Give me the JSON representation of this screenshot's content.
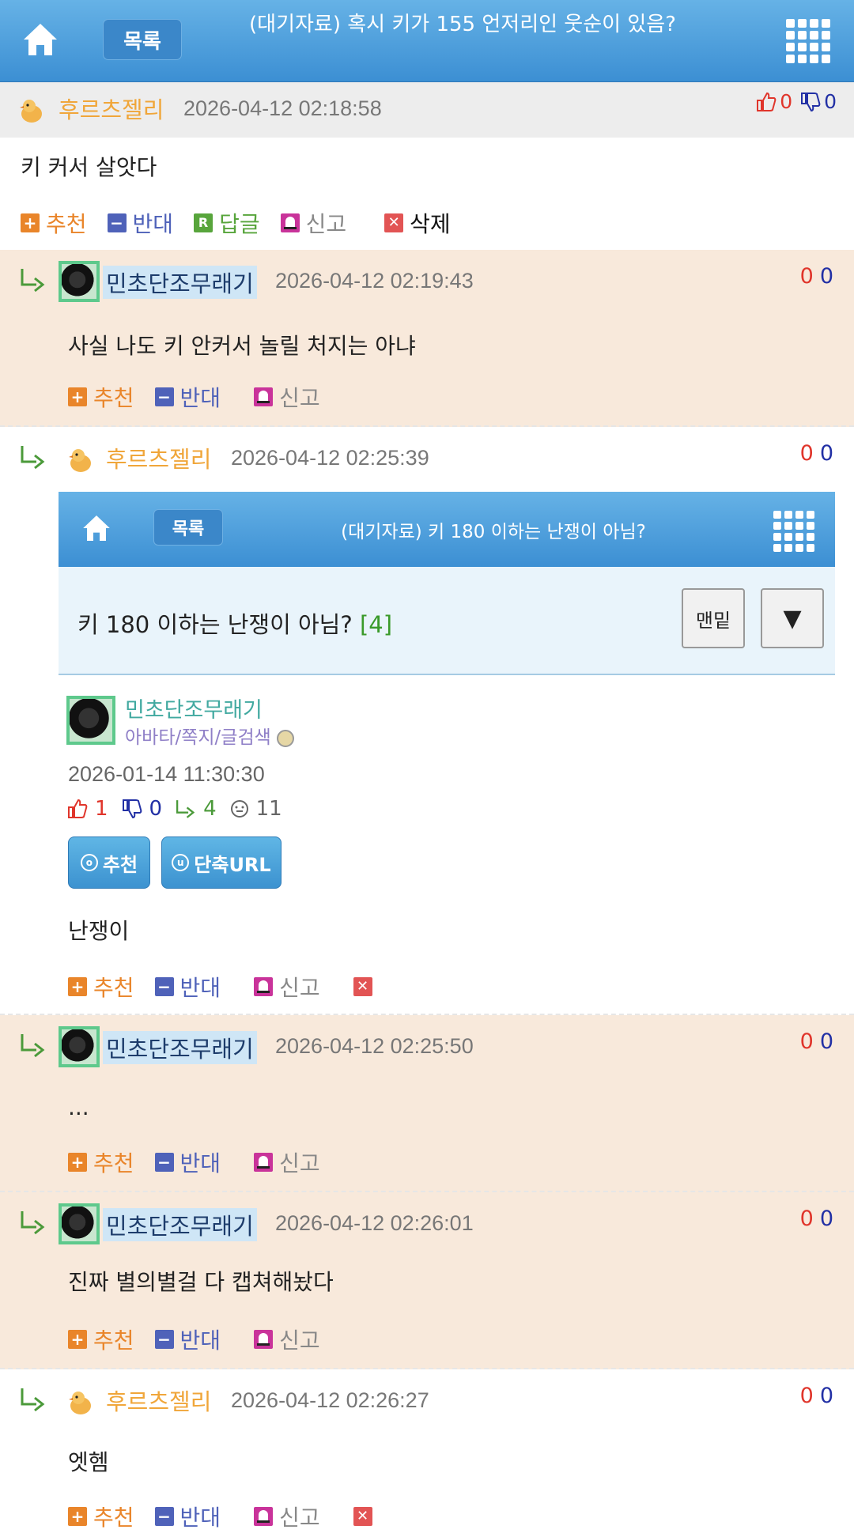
{
  "topbar": {
    "list_label": "목록",
    "title": "(대기자료) 혹시 키가 155 언저리인 웃순이 있음?"
  },
  "main_comment": {
    "nick": "후르츠젤리",
    "time": "2026-04-12 02:18:58",
    "up": "0",
    "down": "0",
    "text": "키 커서 살앗다",
    "actions": {
      "recommend": "추천",
      "oppose": "반대",
      "reply": "답글",
      "report": "신고",
      "delete": "삭제"
    }
  },
  "replies": [
    {
      "nick": "민초단조무래기",
      "time": "2026-04-12 02:19:43",
      "up": "0",
      "down": "0",
      "text": "사실 나도 키 안커서 놀릴 처지는 아냐"
    },
    {
      "nick": "후르츠젤리",
      "time": "2026-04-12 02:25:39",
      "up": "0",
      "down": "0",
      "text": "난쟁이"
    },
    {
      "nick": "민초단조무래기",
      "time": "2026-04-12 02:25:50",
      "up": "0",
      "down": "0",
      "text": "..."
    },
    {
      "nick": "민초단조무래기",
      "time": "2026-04-12 02:26:01",
      "up": "0",
      "down": "0",
      "text": "진짜 별의별걸 다 캡쳐해놨다"
    },
    {
      "nick": "후르츠젤리",
      "time": "2026-04-12 02:26:27",
      "up": "0",
      "down": "0",
      "text": "엣헴"
    }
  ],
  "reply_actions": {
    "recommend": "추천",
    "oppose": "반대",
    "report": "신고"
  },
  "embed": {
    "list_label": "목록",
    "title": "(대기자료) 키 180 이하는 난쟁이 아님?",
    "question": "키 180 이하는 난쟁이 아님?",
    "count": "[4]",
    "bottom_btn": "맨밑",
    "down_btn": "▼",
    "nick": "민초단조무래기",
    "links": "아바타/쪽지/글검색",
    "date": "2026-01-14 11:30:30",
    "likes": "1",
    "dislikes": "0",
    "replies": "4",
    "views": "11",
    "recommend_btn": "추천",
    "shorturl_btn": "단축URL"
  },
  "colors": {
    "accent_blue": "#3c8fd3",
    "peach": "#f8e9db",
    "nick_orange": "#f0a63a"
  }
}
